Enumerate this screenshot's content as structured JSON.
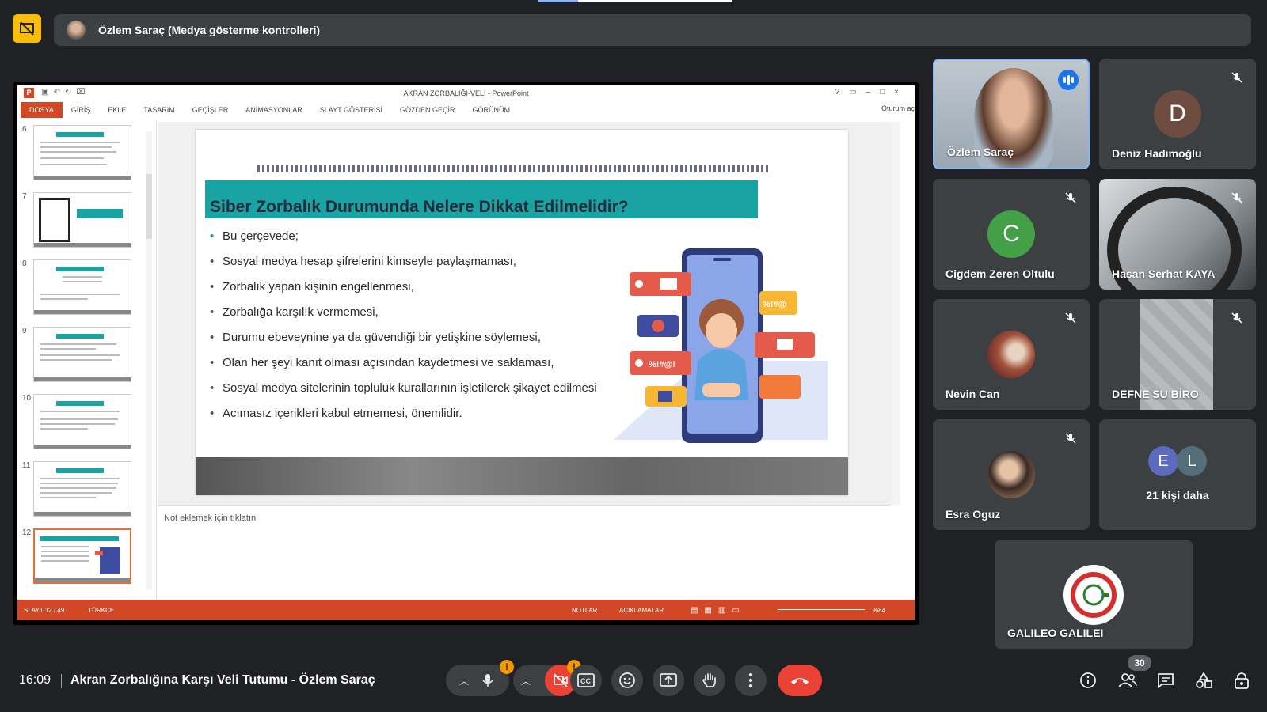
{
  "banner": {
    "presenter_text": "Özlem Saraç (Medya gösterme kontrolleri)"
  },
  "ppt": {
    "window_title": "AKRAN ZORBALIĞI-VELİ - PowerPoint",
    "ribbon_tabs": [
      "DOSYA",
      "GİRİŞ",
      "EKLE",
      "TASARIM",
      "GEÇİŞLER",
      "ANİMASYONLAR",
      "SLAYT GÖSTERİSİ",
      "GÖZDEN GEÇİR",
      "GÖRÜNÜM"
    ],
    "signin": "Oturum aç",
    "thumbnails": [
      "6",
      "7",
      "8",
      "9",
      "10",
      "11",
      "12"
    ],
    "active_thumbnail": "12",
    "slide": {
      "heading": "Siber Zorbalık Durumunda Nelere Dikkat Edilmelidir?",
      "bullets": [
        "Bu çerçevede;",
        "Sosyal medya hesap şifrelerini kimseyle paylaşmaması,",
        "Zorbalık yapan kişinin engellenmesi,",
        "Zorbalığa karşılık vermemesi,",
        "Durumu ebeveynine ya da güvendiği bir yetişkine söylemesi,",
        "Olan her şeyi kanıt olması açısından kaydetmesi ve saklaması,",
        "Sosyal medya sitelerinin topluluk kurallarının işletilerek şikayet edilmesi",
        "Acımasız içerikleri kabul etmemesi, önemlidir."
      ],
      "bubble_text_1": "%!#@",
      "bubble_text_2": "%!#@!"
    },
    "notes_placeholder": "Not eklemek için tıklatın",
    "status": {
      "slide": "SLAYT 12 / 49",
      "language": "TÜRKÇE",
      "notes": "NOTLAR",
      "comments": "AÇIKLAMALAR",
      "zoom": "%84"
    }
  },
  "participants": [
    {
      "name": "Özlem Saraç",
      "state": "speaking"
    },
    {
      "name": "Deniz Hadımoğlu",
      "initial": "D",
      "color": "#6d4c41",
      "state": "muted"
    },
    {
      "name": "Cigdem Zeren Oltulu",
      "initial": "C",
      "color": "#43a047",
      "state": "muted"
    },
    {
      "name": "Hasan Serhat KAYA",
      "state": "muted"
    },
    {
      "name": "Nevin Can",
      "state": "muted"
    },
    {
      "name": "DEFNE SU BİRO",
      "state": "muted"
    },
    {
      "name": "Esra Oguz",
      "state": "muted"
    },
    {
      "name": "21 kişi daha",
      "initials": [
        "E",
        "L"
      ],
      "colors": [
        "#5c6bc0",
        "#546e7a"
      ]
    },
    {
      "name": "GALILEO GALILEI"
    }
  ],
  "bottom_bar": {
    "time": "16:09",
    "meeting_title": "Akran Zorbalığına Karşı Veli Tutumu - Özlem Saraç",
    "warn_symbol": "!",
    "participant_count": "30"
  },
  "colors": {
    "accent": "#1a73e8",
    "end_call": "#ea4335",
    "ppt_orange": "#d24726",
    "slide_teal": "#1aa3a3",
    "warning": "#f29900"
  }
}
